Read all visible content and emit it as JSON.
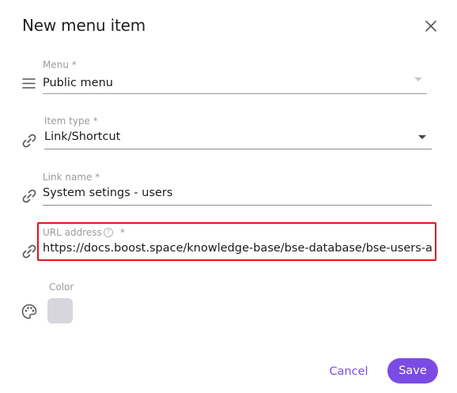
{
  "dialog": {
    "title": "New menu item",
    "close_icon": "close-icon"
  },
  "fields": {
    "menu": {
      "label": "Menu *",
      "value": "Public menu",
      "icon": "menu-lines-icon"
    },
    "item_type": {
      "label": "Item type *",
      "value": "Link/Shortcut",
      "icon": "link-icon"
    },
    "link_name": {
      "label": "Link name *",
      "value": "System setings - users",
      "icon": "link-icon"
    },
    "url_address": {
      "label": "URL address",
      "required_marker": "*",
      "help_icon_text": "?",
      "value": "https://docs.boost.space/knowledge-base/bse-database/bse-users-and-teams/",
      "icon": "link-icon"
    },
    "color": {
      "label": "Color",
      "icon": "palette-icon",
      "swatch": "#d6d6dc"
    }
  },
  "actions": {
    "cancel_label": "Cancel",
    "save_label": "Save"
  },
  "colors": {
    "accent": "#7b4be5",
    "highlight": "#e3111b"
  }
}
